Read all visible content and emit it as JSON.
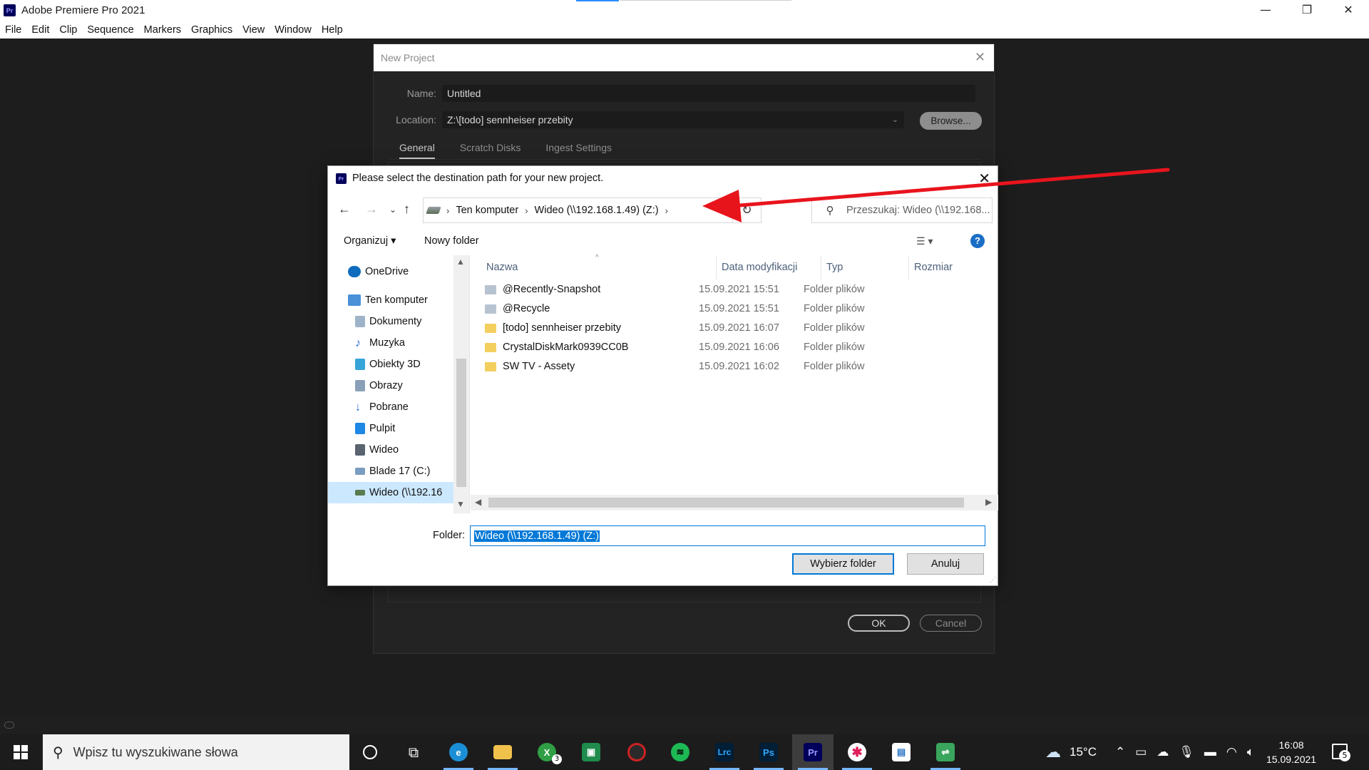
{
  "app": {
    "title": "Adobe Premiere Pro 2021",
    "logo": "Pr",
    "window_controls": {
      "minimize": "—",
      "restore": "❐",
      "close": "✕"
    }
  },
  "menu": [
    "File",
    "Edit",
    "Clip",
    "Sequence",
    "Markers",
    "Graphics",
    "View",
    "Window",
    "Help"
  ],
  "new_project": {
    "title": "New Project",
    "name_label": "Name:",
    "name_value": "Untitled",
    "location_label": "Location:",
    "location_value": "Z:\\[todo] sennheiser przebity",
    "browse_label": "Browse...",
    "tabs": [
      "General",
      "Scratch Disks",
      "Ingest Settings"
    ],
    "ok_label": "OK",
    "cancel_label": "Cancel"
  },
  "file_dialog": {
    "title": "Please select the destination path for your new project.",
    "breadcrumb": [
      "Ten komputer",
      "Wideo (\\\\192.168.1.49) (Z:)"
    ],
    "search_placeholder": "Przeszukaj: Wideo (\\\\192.168...",
    "toolbar": {
      "organize": "Organizuj ▾",
      "new_folder": "Nowy folder",
      "help": "?"
    },
    "tree": [
      {
        "label": "OneDrive",
        "icon": "onedrive-icon",
        "color": "#0f6cbd"
      },
      {
        "label": "Ten komputer",
        "icon": "computer-icon",
        "color": "#4a90d9"
      },
      {
        "label": "Dokumenty",
        "icon": "documents-icon",
        "color": "#9fb3c8"
      },
      {
        "label": "Muzyka",
        "icon": "music-icon",
        "color": "#2b6cd6"
      },
      {
        "label": "Obiekty 3D",
        "icon": "objects-3d-icon",
        "color": "#36a4d8"
      },
      {
        "label": "Obrazy",
        "icon": "pictures-icon",
        "color": "#8aa0b8"
      },
      {
        "label": "Pobrane",
        "icon": "downloads-icon",
        "color": "#2b6cd6"
      },
      {
        "label": "Pulpit",
        "icon": "desktop-icon",
        "color": "#1e88e5"
      },
      {
        "label": "Wideo",
        "icon": "videos-icon",
        "color": "#5a6470"
      },
      {
        "label": "Blade 17 (C:)",
        "icon": "drive-c-icon",
        "color": "#7a9cc0"
      },
      {
        "label": "Wideo (\\\\192.16",
        "icon": "network-drive-icon",
        "color": "#5a7a50"
      }
    ],
    "columns": [
      "Nazwa",
      "Data modyfikacji",
      "Typ",
      "Rozmiar"
    ],
    "files": [
      {
        "name": "@Recently-Snapshot",
        "date": "15.09.2021 15:51",
        "type": "Folder plików",
        "special": true
      },
      {
        "name": "@Recycle",
        "date": "15.09.2021 15:51",
        "type": "Folder plików",
        "special": true
      },
      {
        "name": "[todo] sennheiser przebity",
        "date": "15.09.2021 16:07",
        "type": "Folder plików",
        "special": false
      },
      {
        "name": "CrystalDiskMark0939CC0B",
        "date": "15.09.2021 16:06",
        "type": "Folder plików",
        "special": false
      },
      {
        "name": "SW TV - Assety",
        "date": "15.09.2021 16:02",
        "type": "Folder plików",
        "special": false
      }
    ],
    "folder_label": "Folder:",
    "folder_value": "Wideo (\\\\192.168.1.49) (Z:)",
    "select_button": "Wybierz folder",
    "cancel_button": "Anuluj"
  },
  "annotation": {
    "color": "#e8141c"
  },
  "taskbar": {
    "search_placeholder": "Wpisz tu wyszukiwane słowa",
    "apps": [
      {
        "name": "cortana-icon",
        "label": "○",
        "color": "transparent"
      },
      {
        "name": "task-view-icon",
        "label": "⧉",
        "color": "transparent"
      },
      {
        "name": "edge-icon",
        "label": "e",
        "color": "#1b8fd6"
      },
      {
        "name": "file-explorer-icon",
        "label": "▬",
        "color": "#f0c14b"
      },
      {
        "name": "xbox-icon",
        "label": "X",
        "color": "#2f9e44"
      },
      {
        "name": "spreadsheet-icon",
        "label": "▣",
        "color": "#1f8b4c"
      },
      {
        "name": "davinci-icon",
        "label": "◐",
        "color": "#c22"
      },
      {
        "name": "spotify-icon",
        "label": "≋",
        "color": "#1db954"
      },
      {
        "name": "lightroom-classic-icon",
        "label": "Lrc",
        "color": "#001e36"
      },
      {
        "name": "photoshop-icon",
        "label": "Ps",
        "color": "#001e36"
      },
      {
        "name": "premiere-icon",
        "label": "Pr",
        "color": "#00005b"
      },
      {
        "name": "slack-icon",
        "label": "✱",
        "color": "#4a154b"
      },
      {
        "name": "store-icon",
        "label": "▤",
        "color": "#2a74c6"
      },
      {
        "name": "network-share-icon",
        "label": "⇌",
        "color": "#3aa55c"
      }
    ],
    "xbox_badge": "3",
    "weather": "15°C",
    "time": "16:08",
    "date": "15.09.2021",
    "notifications": "5"
  }
}
